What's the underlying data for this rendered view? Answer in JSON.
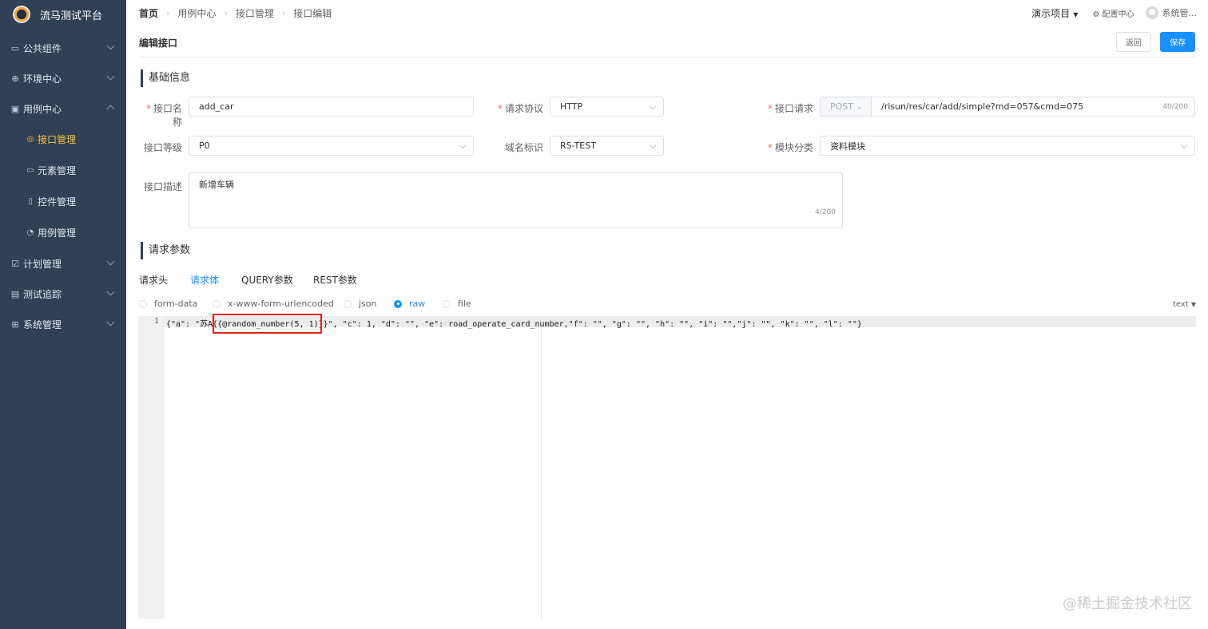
{
  "brand": {
    "name": "流马测试平台"
  },
  "sidebar": {
    "items": [
      {
        "label": "公共组件",
        "icon": "component-icon",
        "glyph": "▭"
      },
      {
        "label": "环境中心",
        "icon": "globe-icon",
        "glyph": "⊕"
      },
      {
        "label": "用例中心",
        "icon": "case-icon",
        "glyph": "▣"
      },
      {
        "label": "计划管理",
        "icon": "plan-icon",
        "glyph": "☑"
      },
      {
        "label": "测试追踪",
        "icon": "trace-icon",
        "glyph": "▤"
      },
      {
        "label": "系统管理",
        "icon": "system-icon",
        "glyph": "⊞"
      }
    ],
    "sub_items": [
      {
        "label": "接口管理",
        "glyph": "◎"
      },
      {
        "label": "元素管理",
        "glyph": "▭"
      },
      {
        "label": "控件管理",
        "glyph": "▯"
      },
      {
        "label": "用例管理",
        "glyph": "◔"
      }
    ]
  },
  "breadcrumb": [
    "首页",
    "用例中心",
    "接口管理",
    "接口编辑"
  ],
  "header": {
    "project": "演示项目",
    "config": "配置中心",
    "user": "系统管..."
  },
  "page": {
    "title": "编辑接口",
    "back_label": "返回",
    "save_label": "保存"
  },
  "basic": {
    "section_title": "基础信息",
    "name_label": "接口名称",
    "name_value": "add_car",
    "protocol_label": "请求协议",
    "protocol_value": "HTTP",
    "request_label": "接口请求",
    "method": "POST",
    "path_value": "/risun/res/car/add/simple?md=057&cmd=075",
    "path_counter": "40/200",
    "level_label": "接口等级",
    "level_value": "P0",
    "domain_label": "域名标识",
    "domain_value": "RS-TEST",
    "module_label": "模块分类",
    "module_value": "资料模块",
    "desc_label": "接口描述",
    "desc_value": "新增车辆",
    "desc_counter": "4/200"
  },
  "params": {
    "section_title": "请求参数",
    "tabs": [
      "请求头",
      "请求体",
      "QUERY参数",
      "REST参数"
    ],
    "active_tab": 1,
    "body_types": [
      "form-data",
      "x-www-form-urlencoded",
      "json",
      "raw",
      "file"
    ],
    "selected_body_type": "raw",
    "mode": "text"
  },
  "editor": {
    "line_number": "1",
    "code": "{\"a\": \"苏A{{@random_number(5, 1)}}\", \"c\": 1, \"d\": \"\", \"e\": road_operate_card_number,\"f\": \"\", \"g\": \"\", \"h\": \"\", \"i\": \"\",\"j\": \"\", \"k\": \"\", \"l\": \"\"}"
  },
  "watermark": "@稀土掘金技术社区"
}
